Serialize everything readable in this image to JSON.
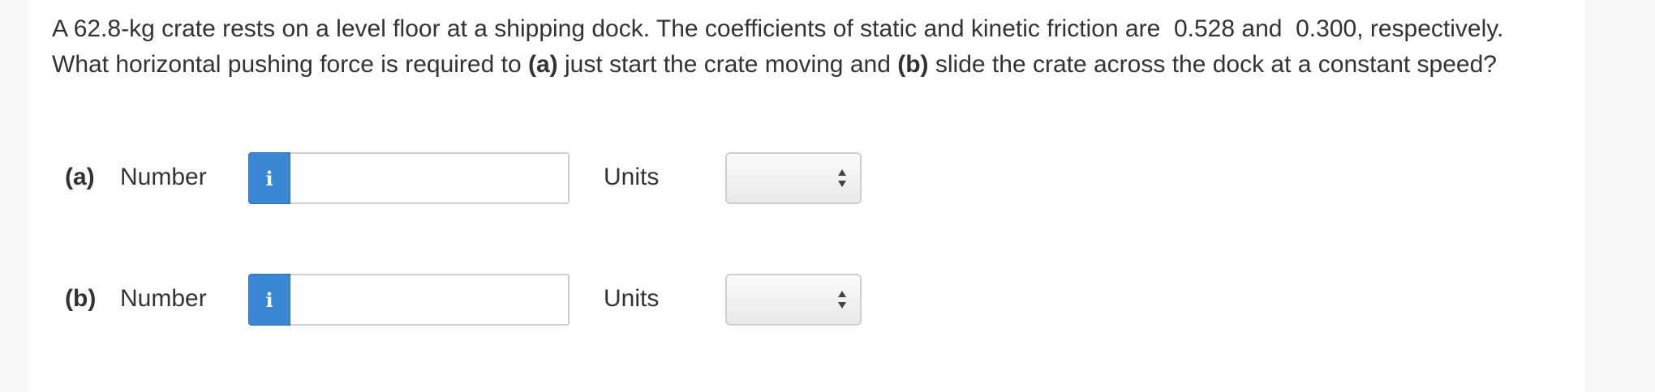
{
  "question": {
    "intro": "A 62.8-kg crate rests on a level floor at a shipping dock. The coefficients of static and kinetic friction are",
    "mu_static": "0.528",
    "and_word": "and",
    "mu_kinetic": "0.300",
    "middle": ", respectively. What horizontal pushing force is required to",
    "part_a_tag": "(a)",
    "part_a_text": "just start the crate moving and",
    "part_b_tag": "(b)",
    "part_b_text": "slide the crate across the dock at a constant speed?"
  },
  "parts": [
    {
      "label": "(a)",
      "number_label": "Number",
      "info_icon": "i",
      "input_value": "",
      "units_label": "Units",
      "units_selected": ""
    },
    {
      "label": "(b)",
      "number_label": "Number",
      "info_icon": "i",
      "input_value": "",
      "units_label": "Units",
      "units_selected": ""
    }
  ],
  "colors": {
    "info_button": "#3a87d6",
    "text": "#333333",
    "border": "#cfcfcf"
  }
}
